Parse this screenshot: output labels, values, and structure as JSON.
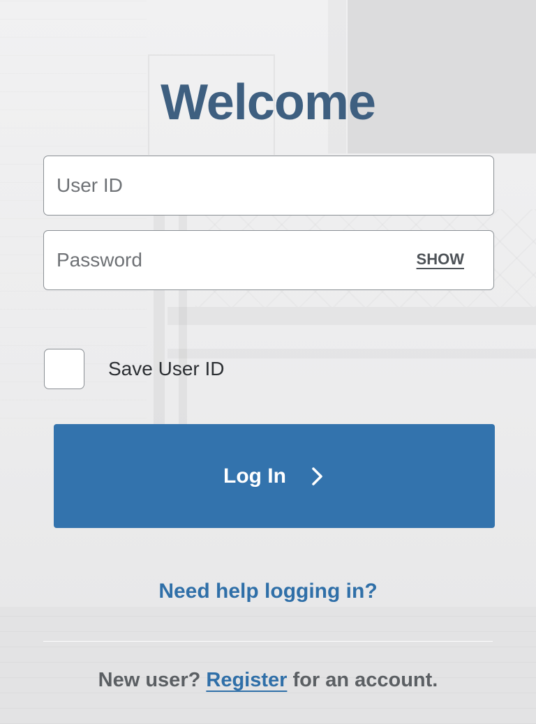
{
  "header": {
    "title": "Welcome"
  },
  "form": {
    "user_id": {
      "placeholder": "User ID",
      "value": ""
    },
    "password": {
      "placeholder": "Password",
      "value": "",
      "show_label": "SHOW"
    },
    "save_user_id": {
      "label": "Save User ID",
      "checked": false
    },
    "login_button": {
      "label": "Log In",
      "icon": "chevron-right-icon"
    }
  },
  "footer": {
    "help_link": "Need help logging in?",
    "register_prefix": "New user? ",
    "register_link": "Register",
    "register_suffix": " for an account."
  },
  "colors": {
    "title": "#3e5f80",
    "primary_button": "#3373ad",
    "link": "#2f6fa8",
    "muted_text": "#5b5f63"
  }
}
